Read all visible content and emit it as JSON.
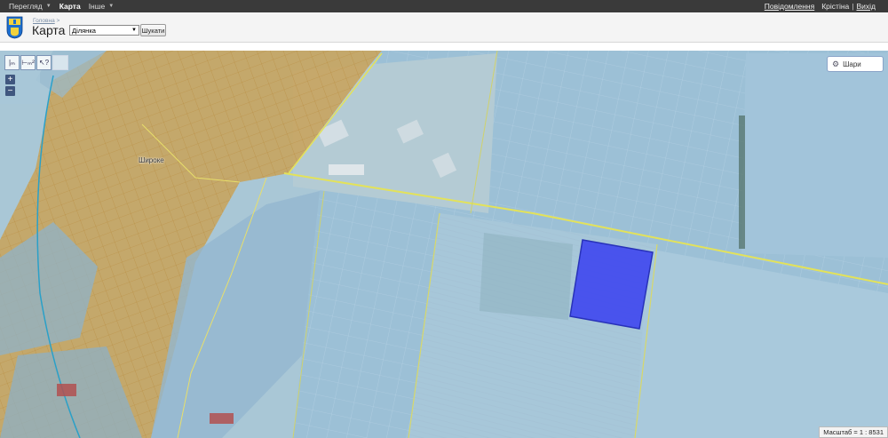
{
  "topbar": {
    "nav": [
      {
        "label": "Перегляд",
        "has_menu": true,
        "active": false
      },
      {
        "label": "Карта",
        "has_menu": false,
        "active": true
      },
      {
        "label": "Інше",
        "has_menu": true,
        "active": false
      }
    ],
    "notifications_link": "Повідомлення",
    "user_name": "Крістіна",
    "separator": "|",
    "logout_link": "Вихід"
  },
  "header": {
    "breadcrumb_home": "Головна",
    "breadcrumb_sep": ">",
    "title": "Карта",
    "select_value": "Ділянка",
    "search_button": "Шукати"
  },
  "map": {
    "tools": [
      {
        "name": "measure-length-icon",
        "glyph": "|ₘ"
      },
      {
        "name": "measure-area-icon",
        "glyph": "⊢ₘ²"
      },
      {
        "name": "identify-icon",
        "glyph": "↖?"
      }
    ],
    "zoom_in": "+",
    "zoom_out": "−",
    "layers_button": "Шари",
    "village_label": "Широке",
    "scale_text": "Масштаб = 1 : 8531"
  },
  "colors": {
    "topbar": "#3a3a3a",
    "parcel_orange": "#d4a35a",
    "parcel_blue": "#8fb6d8",
    "selected_parcel": "#3f47f0",
    "boundary_yellow": "#e3e25a"
  }
}
